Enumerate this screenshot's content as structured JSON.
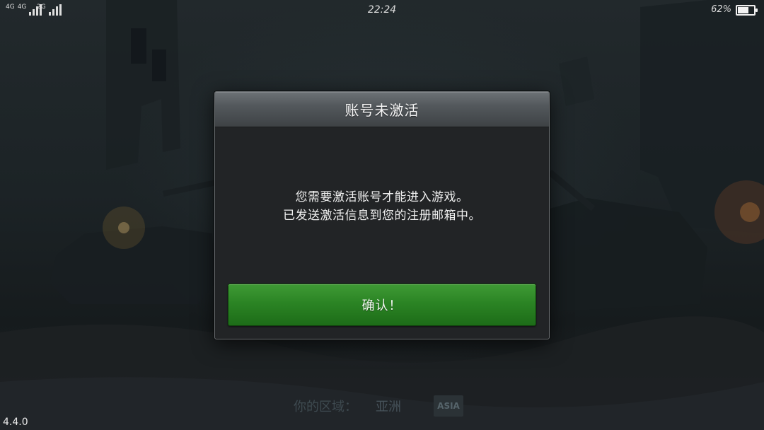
{
  "status_bar": {
    "sim1_network": "4G",
    "sim1_volte": "4G",
    "sim2_network": "2G",
    "time": "22:24",
    "battery_percent_text": "62%",
    "battery_level": 0.62
  },
  "dialog": {
    "title": "账号未激活",
    "message_line_1": "您需要激活账号才能进入游戏。",
    "message_line_2": "已发送激活信息到您的注册邮箱中。",
    "confirm_label": "确认！",
    "confirm_color": "#2b8424"
  },
  "footer": {
    "region_label": "你的区域：",
    "region_value": "亚洲",
    "region_badge": "ASIA",
    "version": "4.4.0"
  }
}
